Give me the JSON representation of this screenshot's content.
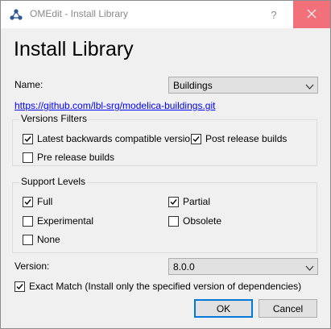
{
  "window": {
    "title": "OMEdit - Install Library",
    "help_glyph": "?",
    "close_glyph": "✕"
  },
  "heading": "Install Library",
  "name": {
    "label": "Name:",
    "selected": "Buildings"
  },
  "url": "https://github.com/lbl-srg/modelica-buildings.git",
  "versions_filters": {
    "title": "Versions Filters",
    "latest_backwards": {
      "label": "Latest backwards compatible versions",
      "checked": true
    },
    "post_release": {
      "label": "Post release builds",
      "checked": true
    },
    "pre_release": {
      "label": "Pre release builds",
      "checked": false
    }
  },
  "support_levels": {
    "title": "Support Levels",
    "full": {
      "label": "Full",
      "checked": true
    },
    "partial": {
      "label": "Partial",
      "checked": true
    },
    "experimental": {
      "label": "Experimental",
      "checked": false
    },
    "obsolete": {
      "label": "Obsolete",
      "checked": false
    },
    "none": {
      "label": "None",
      "checked": false
    }
  },
  "version": {
    "label": "Version:",
    "selected": "8.0.0"
  },
  "exact_match": {
    "label": "Exact Match (Install only the specified version of dependencies)",
    "checked": true
  },
  "buttons": {
    "ok": "OK",
    "cancel": "Cancel"
  },
  "colors": {
    "close_hover": "#f1707a",
    "link": "#0000ff",
    "default_button_border": "#0078d7"
  }
}
